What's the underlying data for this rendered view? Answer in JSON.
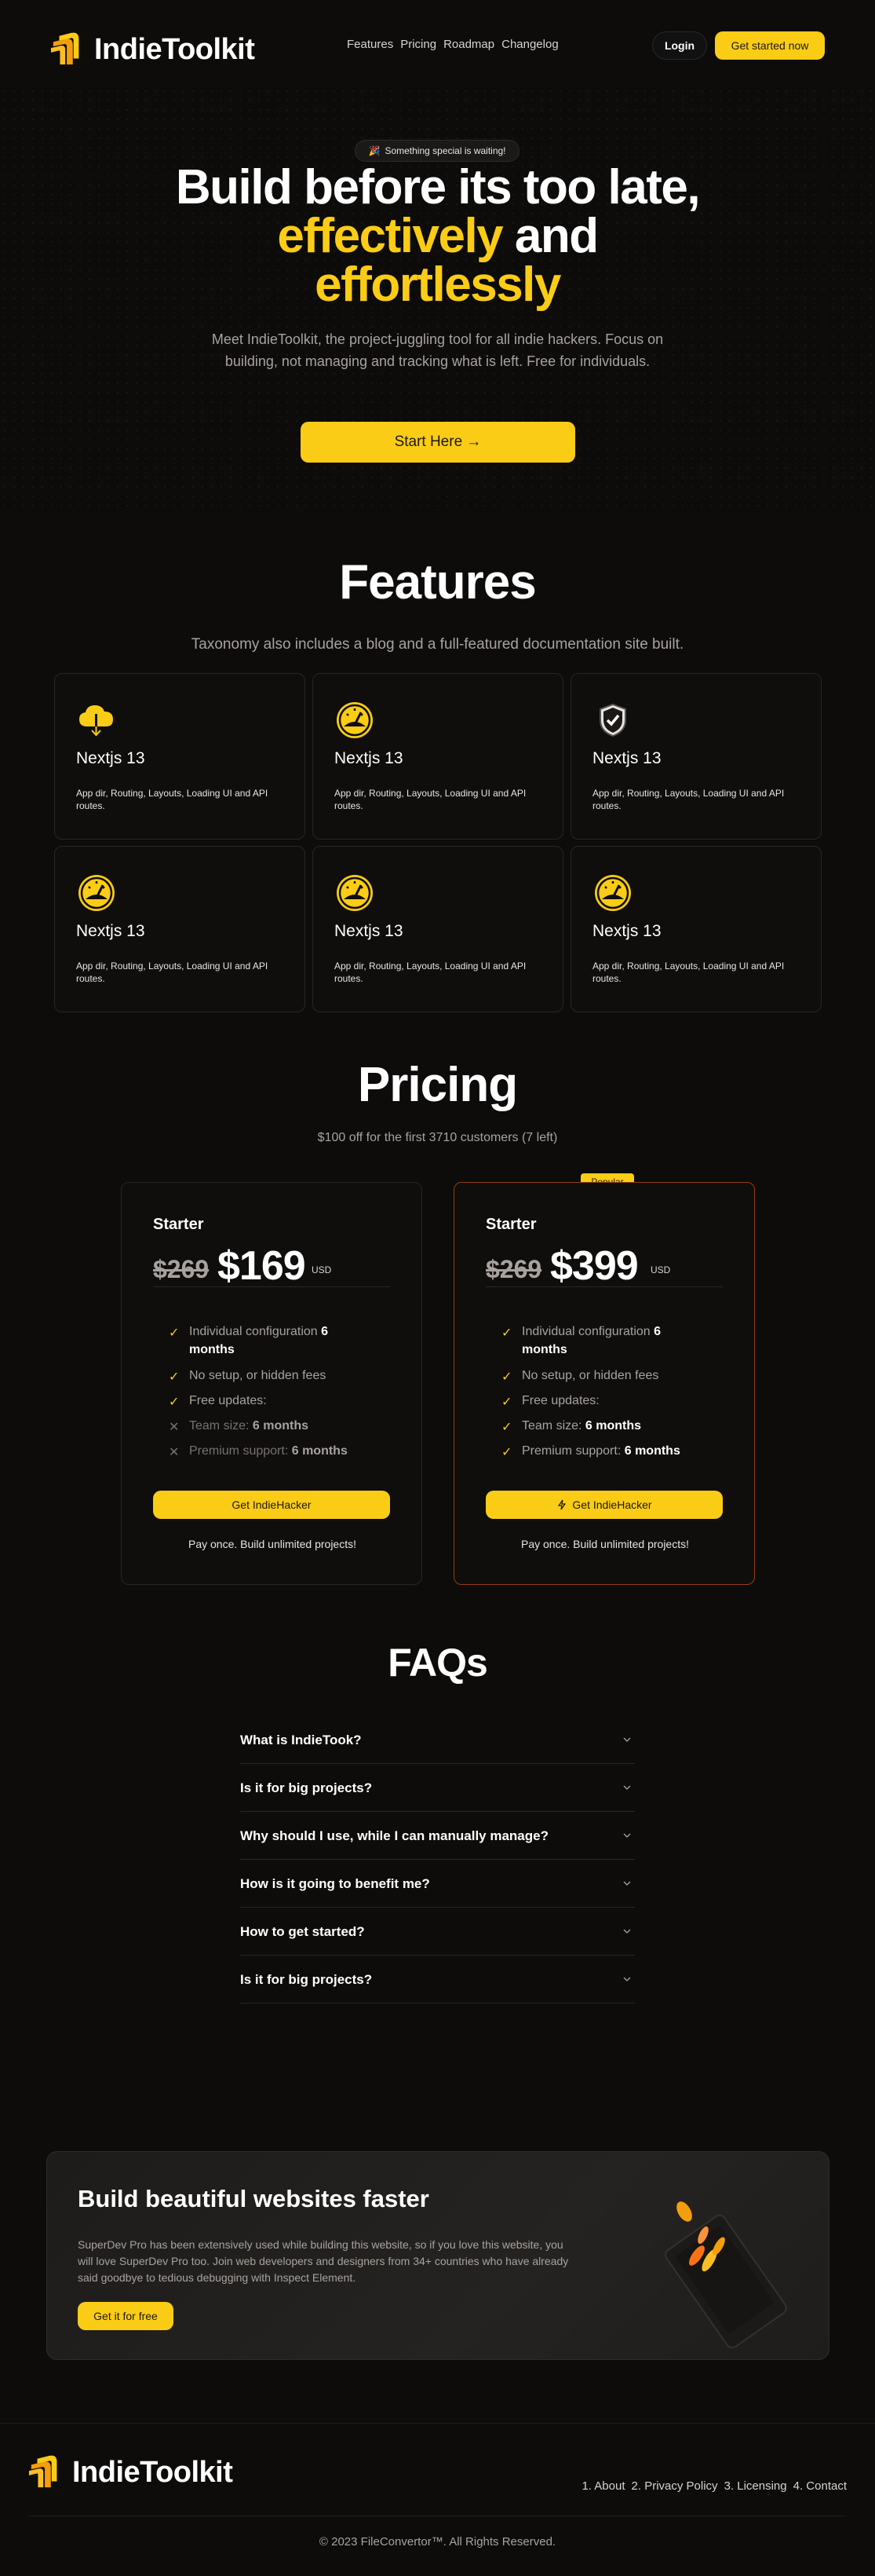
{
  "nav": {
    "brand": "IndieToolkit",
    "links": [
      "Features",
      "Pricing",
      "Roadmap",
      "Changelog"
    ],
    "login": "Login",
    "cta": "Get started now"
  },
  "hero": {
    "badge_icon": "🎉",
    "badge": "Something special is waiting!",
    "title_line1": "Build before its too late,",
    "title_accent1": "effectively",
    "title_plain2": " and",
    "title_accent2": "effortlessly",
    "subtitle": "Meet IndieToolkit, the project-juggling tool for all indie hackers. Focus on building, not managing and tracking what is left. Free for individuals.",
    "button": "Start Here →"
  },
  "features": {
    "title": "Features",
    "subtitle": "Taxonomy also includes a blog and a full-featured documentation site built.",
    "cards": [
      {
        "icon": "cloud-download-icon",
        "title": "Nextjs 13",
        "desc": "App dir, Routing, Layouts, Loading UI and API routes."
      },
      {
        "icon": "gauge-icon",
        "title": "Nextjs 13",
        "desc": "App dir, Routing, Layouts, Loading UI and API routes."
      },
      {
        "icon": "shield-check-icon",
        "title": "Nextjs 13",
        "desc": "App dir, Routing, Layouts, Loading UI and API routes."
      },
      {
        "icon": "gauge-icon",
        "title": "Nextjs 13",
        "desc": "App dir, Routing, Layouts, Loading UI and API routes."
      },
      {
        "icon": "gauge-icon",
        "title": "Nextjs 13",
        "desc": "App dir, Routing, Layouts, Loading UI and API routes."
      },
      {
        "icon": "gauge-icon",
        "title": "Nextjs 13",
        "desc": "App dir, Routing, Layouts, Loading UI and API routes."
      }
    ]
  },
  "pricing": {
    "title": "Pricing",
    "subtitle": "$100 off for the first 3710 customers (7 left)",
    "popular_label": "Popular",
    "plans": [
      {
        "name": "Starter",
        "old_price": "$269",
        "price": "$169",
        "currency": "USD",
        "features": [
          {
            "text": "Individual configuration ",
            "bold": "6 months",
            "enabled": true
          },
          {
            "text": "No setup, or hidden fees",
            "bold": "",
            "enabled": true
          },
          {
            "text": "Free updates:",
            "bold": "",
            "enabled": true
          },
          {
            "text": "Team size: ",
            "bold": "6 months",
            "enabled": false
          },
          {
            "text": "Premium support: ",
            "bold": "6 months",
            "enabled": false
          }
        ],
        "button": "Get IndieHacker",
        "note": "Pay once. Build unlimited projects!"
      },
      {
        "name": "Starter",
        "old_price": "$269",
        "price": "$399",
        "currency": "USD",
        "features": [
          {
            "text": "Individual configuration ",
            "bold": "6 months",
            "enabled": true
          },
          {
            "text": "No setup, or hidden fees",
            "bold": "",
            "enabled": true
          },
          {
            "text": "Free updates:",
            "bold": "",
            "enabled": true
          },
          {
            "text": "Team size: ",
            "bold": "6 months",
            "enabled": true
          },
          {
            "text": "Premium support: ",
            "bold": "6 months",
            "enabled": true
          }
        ],
        "button": "Get IndieHacker",
        "note": "Pay once. Build unlimited projects!"
      }
    ]
  },
  "faq": {
    "title": "FAQs",
    "items": [
      "What is IndieTook?",
      "Is it for big projects?",
      "Why should I use, while I can manually manage?",
      "How is it going to benefit me?",
      "How to get started?",
      "Is it for big projects?"
    ]
  },
  "cta": {
    "title": "Build beautiful websites faster",
    "text": "SuperDev Pro has been extensively used while building this website, so if you love this website, you will love SuperDev Pro too. Join web developers and designers from 34+ countries who have already said goodbye to tedious debugging with Inspect Element.",
    "button": "Get it for free"
  },
  "footer": {
    "brand": "IndieToolkit",
    "links": [
      "1. About",
      "2. Privacy Policy",
      "3. Licensing",
      "4. Contact"
    ],
    "copyright": "© 2023 FileConvertor™. All Rights Reserved."
  },
  "colors": {
    "accent": "#facc15",
    "background": "#0d0c0b",
    "popular_border": "#92400e"
  }
}
